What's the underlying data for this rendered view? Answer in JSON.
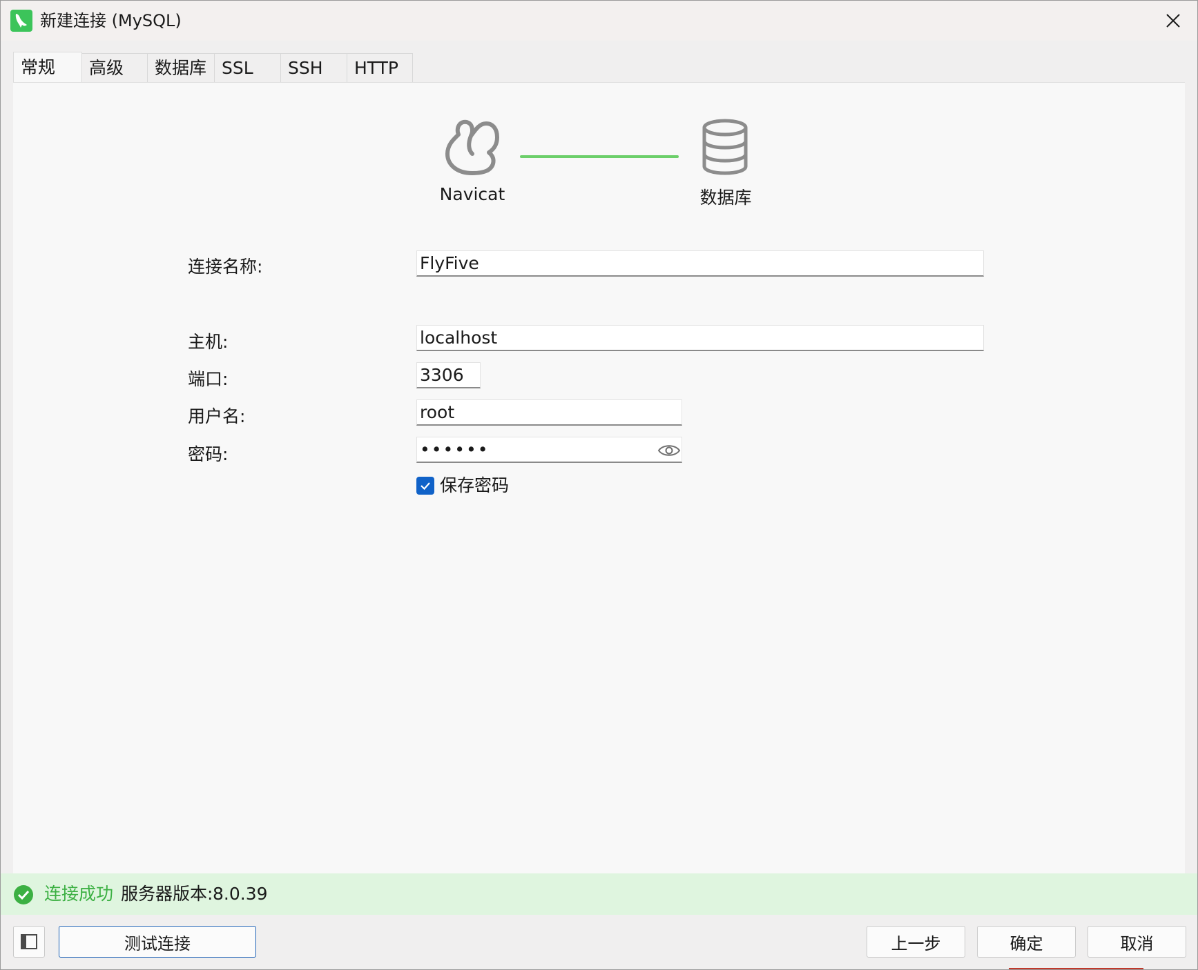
{
  "window": {
    "title": "新建连接 (MySQL)"
  },
  "tabs": [
    {
      "label": "常规",
      "active": true
    },
    {
      "label": "高级",
      "active": false
    },
    {
      "label": "数据库",
      "active": false
    },
    {
      "label": "SSL",
      "active": false
    },
    {
      "label": "SSH",
      "active": false
    },
    {
      "label": "HTTP",
      "active": false
    }
  ],
  "diagram": {
    "left_label": "Navicat",
    "right_label": "数据库",
    "link_color": "#6ccf6a"
  },
  "form": {
    "connection_name": {
      "label": "连接名称:",
      "value": "FlyFive"
    },
    "host": {
      "label": "主机:",
      "value": "localhost"
    },
    "port": {
      "label": "端口:",
      "value": "3306"
    },
    "username": {
      "label": "用户名:",
      "value": "root"
    },
    "password": {
      "label": "密码:",
      "value": "••••••"
    },
    "save_password": {
      "label": "保存密码",
      "checked": true
    }
  },
  "status": {
    "message": "连接成功",
    "version_label": "服务器版本:",
    "version": "8.0.39",
    "color": "#3cb043"
  },
  "footer": {
    "test_button": "测试连接",
    "prev_button": "上一步",
    "ok_button": "确定",
    "cancel_button": "取消"
  },
  "colors": {
    "accent": "#1062c8",
    "status_bg": "#dff5df",
    "app_icon": "#3cc45a"
  },
  "icons": {
    "app": "navicat-dolphin-icon",
    "close": "close-icon",
    "eye": "eye-icon",
    "status": "check-circle-icon",
    "panel_toggle": "sidebar-toggle-icon"
  }
}
